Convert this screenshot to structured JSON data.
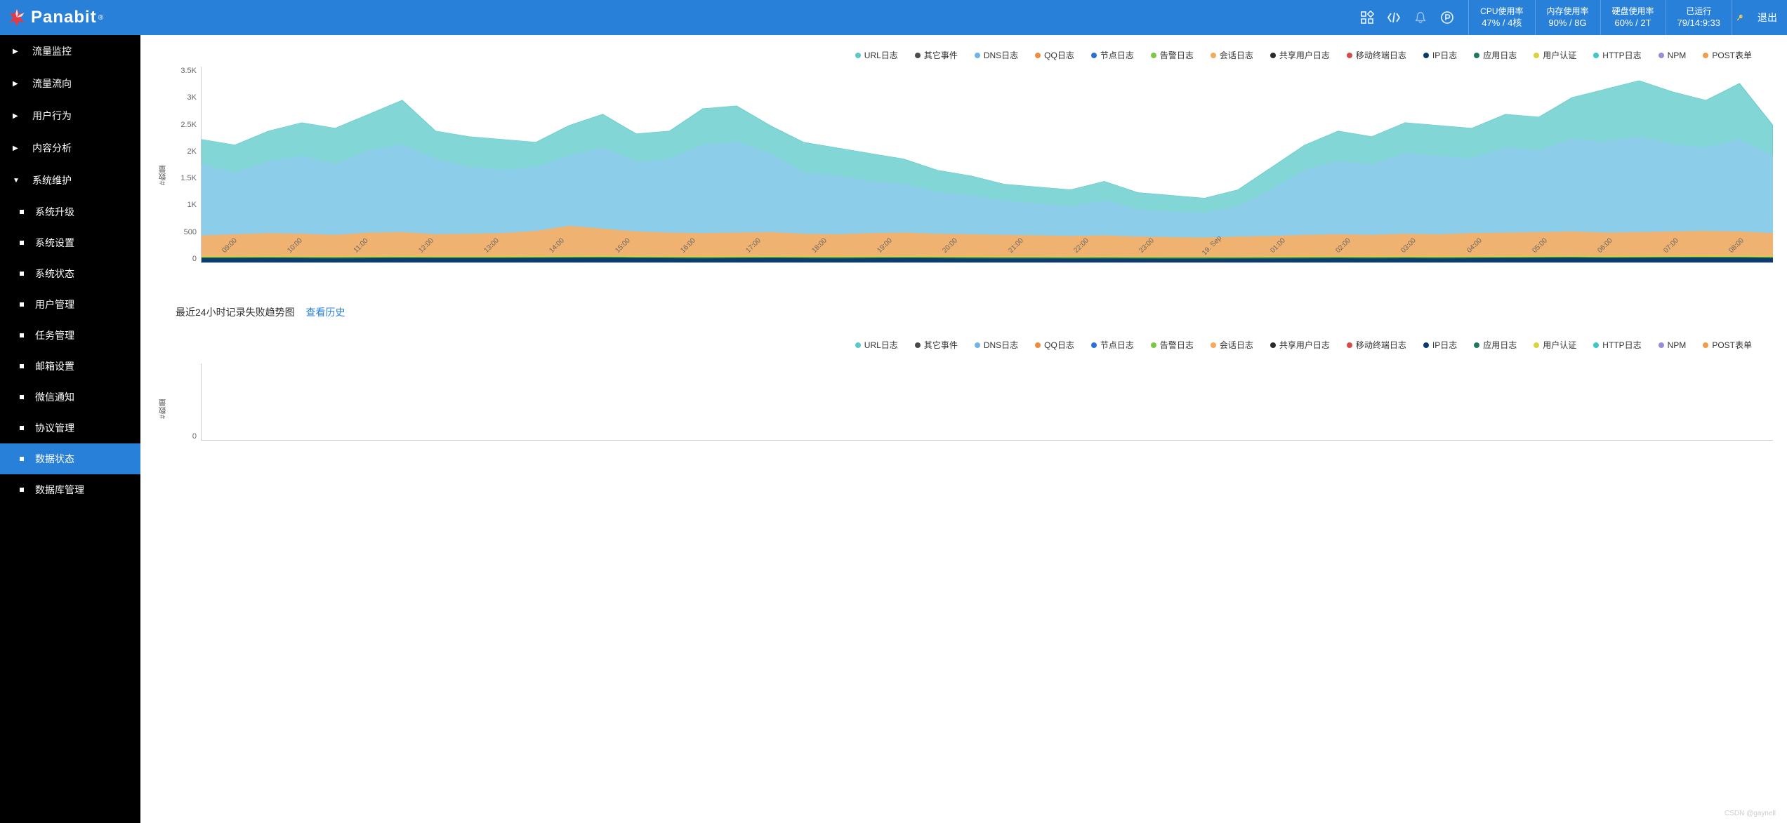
{
  "header": {
    "brand": "Panabit",
    "brand_sup": "®",
    "stats": {
      "cpu_label": "CPU使用率",
      "cpu_value": "47% / 4核",
      "mem_label": "内存使用率",
      "mem_value": "90% / 8G",
      "disk_label": "硬盘使用率",
      "disk_value": "60% / 2T",
      "uptime_label": "已运行",
      "uptime_value": "79/14:9:33"
    },
    "logout": "退出"
  },
  "sidebar": {
    "items": [
      {
        "label": "流量监控",
        "expanded": false
      },
      {
        "label": "流量流向",
        "expanded": false
      },
      {
        "label": "用户行为",
        "expanded": false
      },
      {
        "label": "内容分析",
        "expanded": false
      },
      {
        "label": "系统维护",
        "expanded": true
      }
    ],
    "subs": [
      {
        "label": "系统升级"
      },
      {
        "label": "系统设置"
      },
      {
        "label": "系统状态"
      },
      {
        "label": "用户管理"
      },
      {
        "label": "任务管理"
      },
      {
        "label": "邮箱设置"
      },
      {
        "label": "微信通知"
      },
      {
        "label": "协议管理"
      },
      {
        "label": "数据状态",
        "active": true
      },
      {
        "label": "数据库管理"
      }
    ]
  },
  "legend": [
    {
      "label": "URL日志",
      "color": "#5ac8c8"
    },
    {
      "label": "其它事件",
      "color": "#4a4a4a"
    },
    {
      "label": "DNS日志",
      "color": "#6fb3e8"
    },
    {
      "label": "QQ日志",
      "color": "#f08c3c"
    },
    {
      "label": "节点日志",
      "color": "#2e6fd6"
    },
    {
      "label": "告警日志",
      "color": "#7ac943"
    },
    {
      "label": "会话日志",
      "color": "#f5a95a"
    },
    {
      "label": "共享用户日志",
      "color": "#2a2a2a"
    },
    {
      "label": "移动终端日志",
      "color": "#d94a4a"
    },
    {
      "label": "IP日志",
      "color": "#0b3a6f"
    },
    {
      "label": "应用日志",
      "color": "#1e7a5a"
    },
    {
      "label": "用户认证",
      "color": "#d9d33c"
    },
    {
      "label": "HTTP日志",
      "color": "#3cc8c8"
    },
    {
      "label": "NPM",
      "color": "#9a8ad9"
    },
    {
      "label": "POST表单",
      "color": "#f29c4a"
    }
  ],
  "section2": {
    "title": "最近24小时记录失败趋势图",
    "link": "查看历史"
  },
  "ylabel": "#数量",
  "watermark": "CSDN @gaynell",
  "chart_data": [
    {
      "type": "area",
      "title": "",
      "ylabel": "#数量",
      "ylim": [
        0,
        3500
      ],
      "y_ticks": [
        "0",
        "500",
        "1K",
        "1.5K",
        "2K",
        "2.5K",
        "3K",
        "3.5K"
      ],
      "x": [
        "09:00",
        "10:00",
        "11:00",
        "12:00",
        "13:00",
        "14:00",
        "15:00",
        "16:00",
        "17:00",
        "18:00",
        "19:00",
        "20:00",
        "21:00",
        "22:00",
        "23:00",
        "19. Sep",
        "01:00",
        "02:00",
        "03:00",
        "04:00",
        "05:00",
        "06:00",
        "07:00",
        "08:00"
      ],
      "series": [
        {
          "name": "URL日志",
          "color": "#5ac8c8",
          "values": [
            2200,
            2100,
            2350,
            2500,
            2400,
            2650,
            2900,
            2350,
            2250,
            2200,
            2150,
            2450,
            2650,
            2300,
            2350,
            2750,
            2800,
            2450,
            2150,
            2050,
            1950,
            1850,
            1650,
            1550,
            1400,
            1350,
            1300,
            1450,
            1250,
            1200,
            1150,
            1300,
            1700,
            2100,
            2350,
            2250,
            2500,
            2450,
            2400,
            2650,
            2600,
            2950,
            3100,
            3250,
            3050,
            2900,
            3200,
            2450
          ]
        },
        {
          "name": "DNS日志",
          "color": "#8fc9f0",
          "values": [
            1750,
            1600,
            1800,
            1900,
            1750,
            2000,
            2100,
            1850,
            1700,
            1650,
            1700,
            1900,
            2050,
            1800,
            1850,
            2100,
            2150,
            1950,
            1600,
            1550,
            1450,
            1400,
            1250,
            1200,
            1100,
            1050,
            1000,
            1100,
            950,
            900,
            880,
            1000,
            1300,
            1650,
            1800,
            1750,
            1950,
            1900,
            1850,
            2050,
            2000,
            2200,
            2150,
            2250,
            2100,
            2050,
            2200,
            1900
          ]
        },
        {
          "name": "会话日志",
          "color": "#f5b06a",
          "values": [
            480,
            500,
            520,
            510,
            490,
            530,
            540,
            500,
            510,
            520,
            560,
            650,
            600,
            550,
            530,
            520,
            530,
            540,
            510,
            500,
            520,
            530,
            510,
            500,
            490,
            480,
            470,
            480,
            460,
            450,
            440,
            460,
            470,
            490,
            500,
            490,
            510,
            500,
            520,
            530,
            540,
            550,
            530,
            540,
            550,
            560,
            550,
            520
          ]
        },
        {
          "name": "用户认证",
          "color": "#d9d33c",
          "values": [
            110,
            110,
            115,
            110,
            108,
            112,
            114,
            110,
            110,
            112,
            115,
            118,
            120,
            115,
            112,
            110,
            112,
            114,
            112,
            110,
            112,
            114,
            112,
            110,
            108,
            108,
            106,
            108,
            106,
            104,
            104,
            106,
            108,
            110,
            112,
            110,
            112,
            110,
            112,
            114,
            116,
            118,
            114,
            116,
            118,
            120,
            118,
            114
          ]
        },
        {
          "name": "应用日志",
          "color": "#1e7a5a",
          "values": [
            90,
            90,
            92,
            90,
            88,
            90,
            92,
            90,
            90,
            90,
            92,
            94,
            95,
            92,
            90,
            88,
            90,
            92,
            90,
            88,
            90,
            92,
            90,
            88,
            86,
            86,
            84,
            86,
            84,
            82,
            82,
            84,
            86,
            88,
            90,
            88,
            90,
            88,
            90,
            92,
            94,
            96,
            92,
            94,
            96,
            98,
            96,
            92
          ]
        },
        {
          "name": "IP日志",
          "color": "#0b3a6f",
          "values": [
            70,
            70,
            72,
            70,
            68,
            70,
            72,
            70,
            70,
            70,
            72,
            74,
            75,
            72,
            70,
            68,
            70,
            72,
            70,
            68,
            70,
            72,
            70,
            68,
            66,
            66,
            64,
            66,
            64,
            62,
            62,
            64,
            66,
            68,
            70,
            68,
            70,
            68,
            70,
            72,
            74,
            76,
            72,
            74,
            76,
            78,
            76,
            72
          ]
        }
      ]
    },
    {
      "type": "area",
      "title": "最近24小时记录失败趋势图",
      "ylabel": "#数量",
      "ylim": [
        0,
        1
      ],
      "y_ticks": [
        "0"
      ],
      "x": [],
      "series": []
    }
  ]
}
